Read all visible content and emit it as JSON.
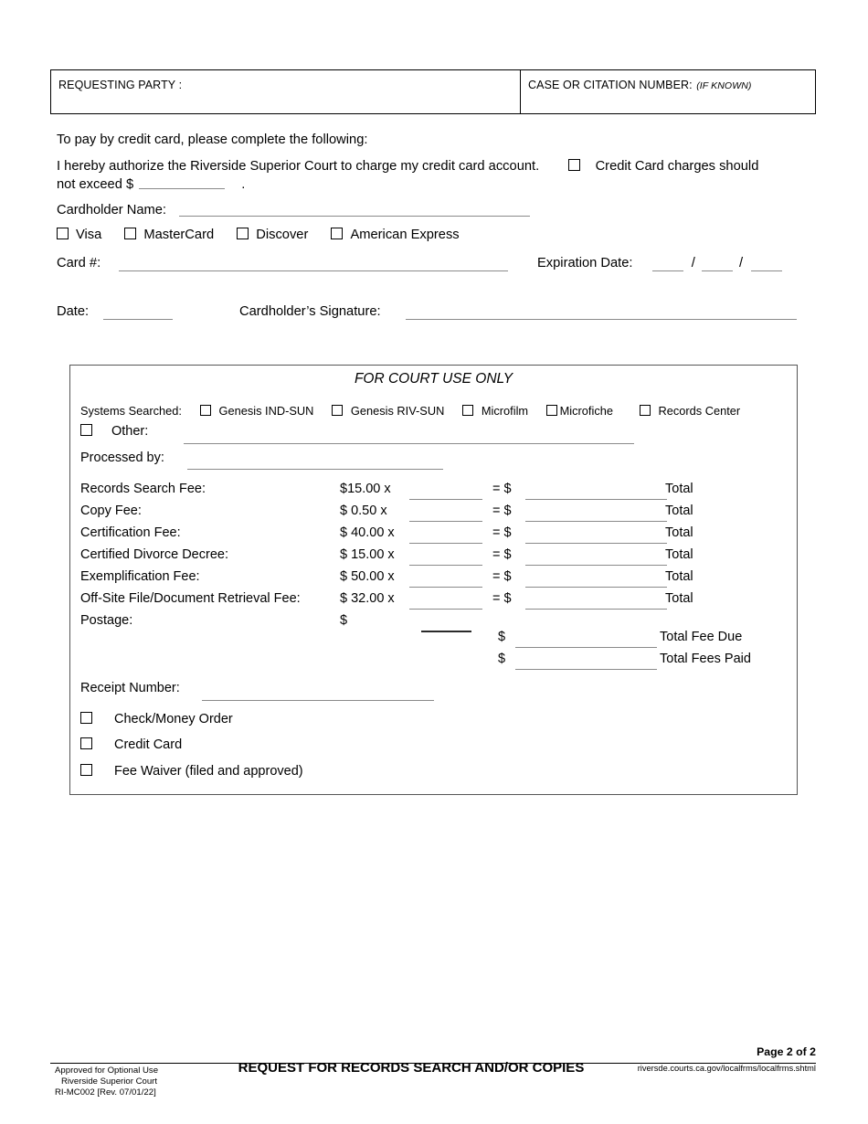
{
  "header_box": {
    "requesting_party_label": "REQUESTING PARTY :",
    "case_number_label": "CASE OR CITATION NUMBER:",
    "case_number_note": "(IF KNOWN)"
  },
  "credit_card_section": {
    "pay_instruction": "To pay by credit card, please complete the following:",
    "authorize_line1": "I hereby authorize the Riverside Superior Court to charge my credit card account.",
    "authorize_checkbox_label": "Credit Card charges should",
    "authorize_line2_prefix": "not exceed $",
    "authorize_line2_suffix": ".",
    "cardholder_name_label": "Cardholder Name:",
    "card_types": [
      "Visa",
      "MasterCard",
      "Discover",
      "American Express"
    ],
    "card_number_label": "Card #:",
    "expiration_label": "Expiration Date:",
    "expiration_separator": "/",
    "date_label": "Date:",
    "signature_label": "Cardholder’s Signature:"
  },
  "court_use": {
    "title": "FOR COURT USE ONLY",
    "systems_searched_label": "Systems Searched:",
    "systems": [
      "Genesis IND-SUN",
      "Genesis RIV-SUN",
      "Microfilm",
      "Microfiche",
      "Records Center"
    ],
    "other_label": "Other:",
    "processed_by_label": "Processed by:",
    "fee_rows": [
      {
        "label": "Records Search Fee:",
        "amount": "$15.00  x",
        "equals": "= $",
        "total": "Total"
      },
      {
        "label": "Copy Fee:",
        "amount": "$  0.50  x",
        "equals": "= $",
        "total": "Total"
      },
      {
        "label": "Certification Fee:",
        "amount": "$ 40.00 x",
        "equals": "= $",
        "total": "Total"
      },
      {
        "label": "Certified Divorce Decree:",
        "amount": "$ 15.00 x",
        "equals": "= $",
        "total": "Total"
      },
      {
        "label": "Exemplification Fee:",
        "amount": "$ 50.00 x",
        "equals": "= $",
        "total": "Total"
      },
      {
        "label": "Off-Site File/Document Retrieval Fee:",
        "amount": "$ 32.00 x",
        "equals": "= $",
        "total": "Total"
      }
    ],
    "postage_label": "Postage:",
    "postage_dollar": "$",
    "grand_rows": [
      {
        "dollar": "$",
        "label": "Total Fee Due"
      },
      {
        "dollar": "$",
        "label": "Total Fees Paid"
      }
    ],
    "receipt_number_label": "Receipt Number:",
    "payment_options": [
      "Check/Money Order",
      "Credit Card",
      "Fee Waiver (filed and approved)"
    ]
  },
  "footer": {
    "page_number": "Page 2 of 2",
    "approved_line1": "Approved for Optional Use",
    "approved_line2": "Riverside Superior Court",
    "approved_line3": "RI-MC002 [Rev. 07/01/22]",
    "form_title": "REQUEST FOR RECORDS SEARCH AND/OR COPIES",
    "url": "riversde.courts.ca.gov/localfrms/localfrms.shtml"
  }
}
